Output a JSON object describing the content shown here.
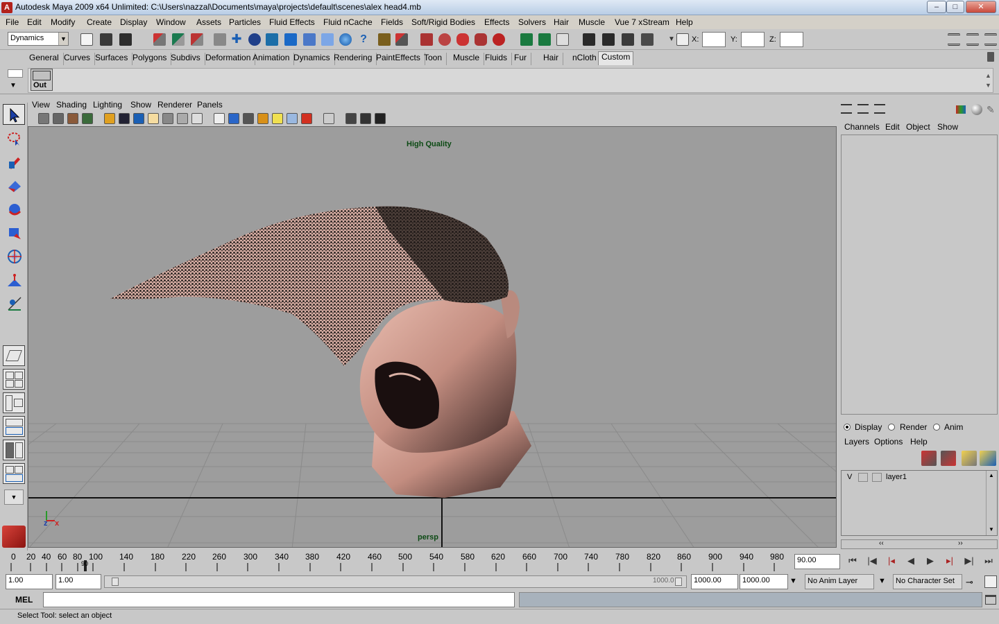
{
  "window": {
    "title": "Autodesk Maya 2009 x64 Unlimited: C:\\Users\\nazzal\\Documents\\maya\\projects\\default\\scenes\\alex head4.mb",
    "app_icon": "A",
    "minimize": "–",
    "maximize": "□",
    "close": "✕"
  },
  "menubar": [
    "File",
    "Edit",
    "Modify",
    "Create",
    "Display",
    "Window",
    "Assets",
    "Particles",
    "Fluid Effects",
    "Fluid nCache",
    "Fields",
    "Soft/Rigid Bodies",
    "Effects",
    "Solvers",
    "Hair",
    "Muscle",
    "Vue 7 xStream",
    "Help"
  ],
  "statusline": {
    "menu_set": "Dynamics",
    "x_label": "X:",
    "y_label": "Y:",
    "z_label": "Z:"
  },
  "shelf_tabs": [
    "General",
    "Curves",
    "Surfaces",
    "Polygons",
    "Subdivs",
    "Deformation",
    "Animation",
    "Dynamics",
    "Rendering",
    "PaintEffects",
    "Toon",
    "Muscle",
    "Fluids",
    "Fur",
    "Hair",
    "nCloth",
    "Custom"
  ],
  "shelf": {
    "out_button": "Out"
  },
  "panel": {
    "menus": [
      "View",
      "Shading",
      "Lighting",
      "Show",
      "Renderer",
      "Panels"
    ],
    "hq_label": "High Quality",
    "camera_label": "persp",
    "axis_z": "z",
    "axis_x": "x"
  },
  "channel_box": {
    "menus": [
      "Channels",
      "Edit",
      "Object",
      "Show"
    ]
  },
  "layer_editor": {
    "modes": [
      {
        "label": "Display",
        "selected": true
      },
      {
        "label": "Render",
        "selected": false
      },
      {
        "label": "Anim",
        "selected": false
      }
    ],
    "menus": [
      "Layers",
      "Options",
      "Help"
    ],
    "layers": [
      {
        "visibility": "V",
        "name": "layer1"
      }
    ]
  },
  "time_slider": {
    "ticks": [
      "0",
      "20",
      "40",
      "60",
      "80",
      "100",
      "140",
      "180",
      "220",
      "260",
      "300",
      "340",
      "380",
      "420",
      "460",
      "500",
      "540",
      "580",
      "620",
      "660",
      "700",
      "740",
      "780",
      "820",
      "860",
      "900",
      "940",
      "980"
    ],
    "current_frame_marker": "90",
    "current_time": "90.00"
  },
  "range_slider": {
    "start_time": "1.00",
    "playback_start": "1.00",
    "range_end_inner": "1000.0",
    "playback_end": "1000.00",
    "end_time": "1000.00",
    "anim_layer": "No Anim Layer",
    "character_set": "No Character Set"
  },
  "command_line": {
    "label": "MEL",
    "value": ""
  },
  "help_line": {
    "text": "Select Tool: select an object"
  },
  "colors": {
    "viewport_bg": "#9d9d9d",
    "ui_gray": "#c8c8c8",
    "label_green": "#0c4a14",
    "skin": "#d9a99c"
  }
}
